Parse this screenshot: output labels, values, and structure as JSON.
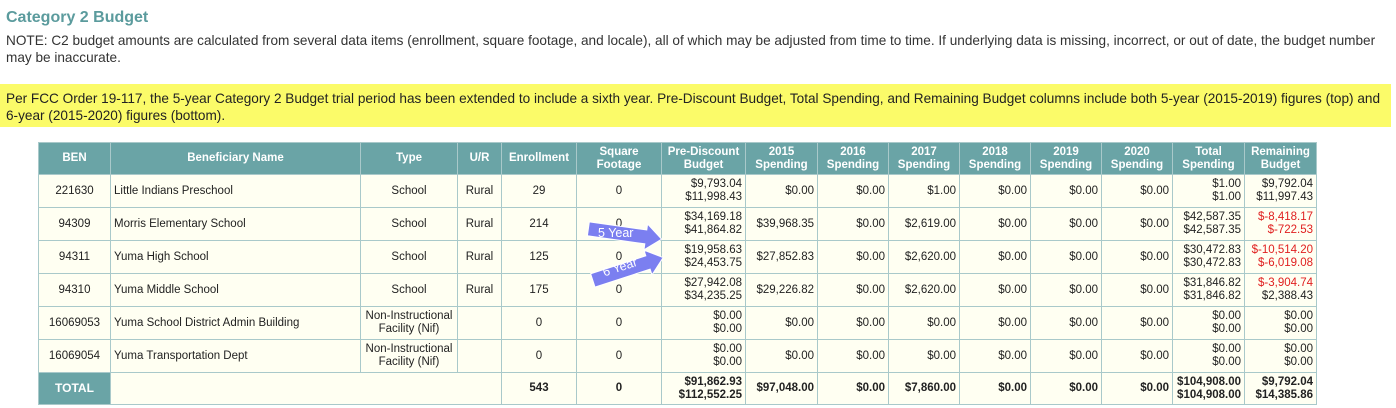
{
  "header": {
    "title": "Category 2 Budget",
    "note": "NOTE: C2 budget amounts are calculated from several data items (enrollment, square footage, and locale), all of which may be adjusted from time to time. If underlying data is missing, incorrect, or out of date, the budget number may be inaccurate.",
    "highlight": "Per FCC Order 19-117, the 5-year Category 2 Budget trial period has been extended to include a sixth year. Pre-Discount Budget, Total Spending, and Remaining Budget columns include both 5-year (2015-2019) figures (top) and 6-year (2015-2020) figures (bottom)."
  },
  "table": {
    "columns": {
      "ben": "BEN",
      "name": "Beneficiary Name",
      "type": "Type",
      "ur": "U/R",
      "enrollment": "Enrollment",
      "sqft_1": "Square",
      "sqft_2": "Footage",
      "budget_1": "Pre-Discount",
      "budget_2": "Budget",
      "s2015_1": "2015",
      "s2016_1": "2016",
      "s2017_1": "2017",
      "s2018_1": "2018",
      "s2019_1": "2019",
      "s2020_1": "2020",
      "spending": "Spending",
      "total_1": "Total",
      "remaining_1": "Remaining"
    },
    "rows": [
      {
        "ben": "221630",
        "name": "Little Indians Preschool",
        "type1": "School",
        "type2": "",
        "ur": "Rural",
        "enrollment": "29",
        "sqft": "0",
        "budget_top": "$9,793.04",
        "budget_bottom": "$11,998.43",
        "s2015": "$0.00",
        "s2016": "$0.00",
        "s2017": "$1.00",
        "s2018": "$0.00",
        "s2019": "$0.00",
        "s2020": "$0.00",
        "total_top": "$1.00",
        "total_bottom": "$1.00",
        "rem_top": "$9,792.04",
        "rem_bottom": "$11,997.43"
      },
      {
        "ben": "94309",
        "name": "Morris Elementary School",
        "type1": "School",
        "type2": "",
        "ur": "Rural",
        "enrollment": "214",
        "sqft": "0",
        "budget_top": "$34,169.18",
        "budget_bottom": "$41,864.82",
        "s2015": "$39,968.35",
        "s2016": "$0.00",
        "s2017": "$2,619.00",
        "s2018": "$0.00",
        "s2019": "$0.00",
        "s2020": "$0.00",
        "total_top": "$42,587.35",
        "total_bottom": "$42,587.35",
        "rem_top": "$-8,418.17",
        "rem_bottom": "$-722.53"
      },
      {
        "ben": "94311",
        "name": "Yuma High School",
        "type1": "School",
        "type2": "",
        "ur": "Rural",
        "enrollment": "125",
        "sqft": "0",
        "budget_top": "$19,958.63",
        "budget_bottom": "$24,453.75",
        "s2015": "$27,852.83",
        "s2016": "$0.00",
        "s2017": "$2,620.00",
        "s2018": "$0.00",
        "s2019": "$0.00",
        "s2020": "$0.00",
        "total_top": "$30,472.83",
        "total_bottom": "$30,472.83",
        "rem_top": "$-10,514.20",
        "rem_bottom": "$-6,019.08"
      },
      {
        "ben": "94310",
        "name": "Yuma Middle School",
        "type1": "School",
        "type2": "",
        "ur": "Rural",
        "enrollment": "175",
        "sqft": "0",
        "budget_top": "$27,942.08",
        "budget_bottom": "$34,235.25",
        "s2015": "$29,226.82",
        "s2016": "$0.00",
        "s2017": "$2,620.00",
        "s2018": "$0.00",
        "s2019": "$0.00",
        "s2020": "$0.00",
        "total_top": "$31,846.82",
        "total_bottom": "$31,846.82",
        "rem_top": "$-3,904.74",
        "rem_bottom": "$2,388.43"
      },
      {
        "ben": "16069053",
        "name": "Yuma School District Admin Building",
        "type1": "Non-Instructional",
        "type2": "Facility (Nif)",
        "ur": "",
        "enrollment": "0",
        "sqft": "0",
        "budget_top": "$0.00",
        "budget_bottom": "$0.00",
        "s2015": "$0.00",
        "s2016": "$0.00",
        "s2017": "$0.00",
        "s2018": "$0.00",
        "s2019": "$0.00",
        "s2020": "$0.00",
        "total_top": "$0.00",
        "total_bottom": "$0.00",
        "rem_top": "$0.00",
        "rem_bottom": "$0.00"
      },
      {
        "ben": "16069054",
        "name": "Yuma Transportation Dept",
        "type1": "Non-Instructional",
        "type2": "Facility (Nif)",
        "ur": "",
        "enrollment": "0",
        "sqft": "0",
        "budget_top": "$0.00",
        "budget_bottom": "$0.00",
        "s2015": "$0.00",
        "s2016": "$0.00",
        "s2017": "$0.00",
        "s2018": "$0.00",
        "s2019": "$0.00",
        "s2020": "$0.00",
        "total_top": "$0.00",
        "total_bottom": "$0.00",
        "rem_top": "$0.00",
        "rem_bottom": "$0.00"
      }
    ],
    "total": {
      "label": "TOTAL",
      "enrollment": "543",
      "sqft": "0",
      "budget_top": "$91,862.93",
      "budget_bottom": "$112,552.25",
      "s2015": "$97,048.00",
      "s2016": "$0.00",
      "s2017": "$7,860.00",
      "s2018": "$0.00",
      "s2019": "$0.00",
      "s2020": "$0.00",
      "total_top": "$104,908.00",
      "total_bottom": "$104,908.00",
      "rem_top": "$9,792.04",
      "rem_bottom": "$14,385.86"
    }
  },
  "callouts": {
    "five_year": "5 Year",
    "six_year": "6 Year",
    "color": "#7b7ff0"
  },
  "colors": {
    "title": "#5b9b9d",
    "header_bg": "#6aa4a6",
    "highlight": "#fbfb69",
    "negative": "#e02020"
  }
}
